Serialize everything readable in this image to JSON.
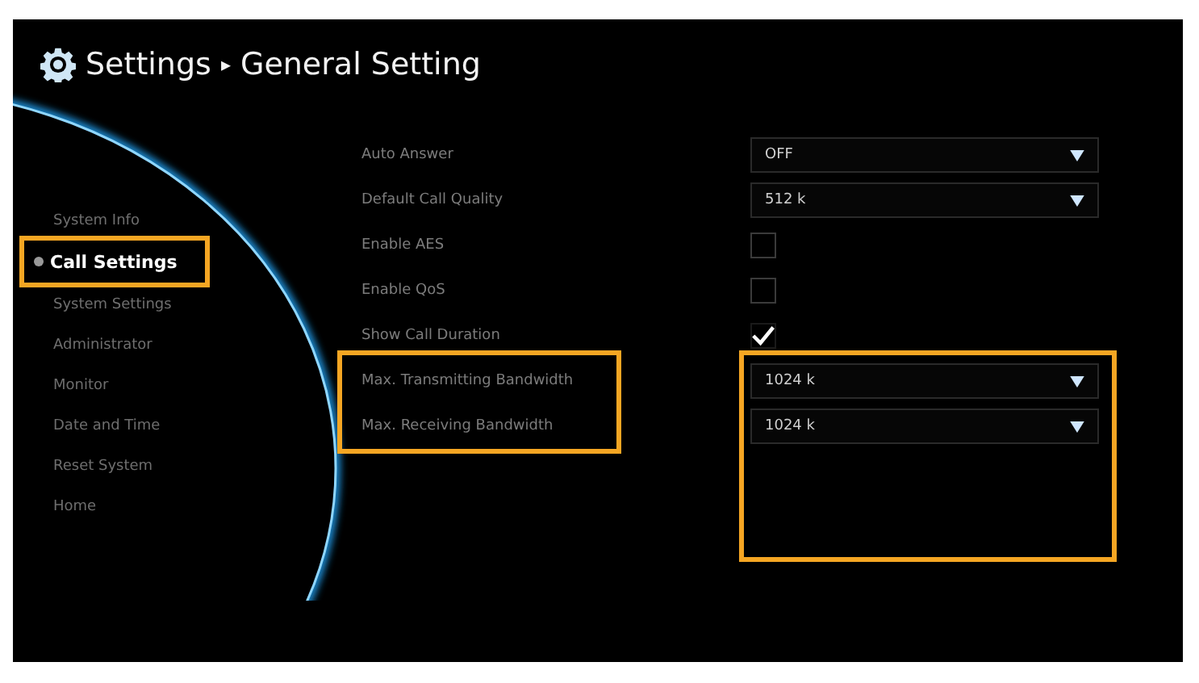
{
  "title": {
    "section": "Settings",
    "separator": "▸",
    "page": "General Setting"
  },
  "sidebar": {
    "items": [
      {
        "label": "System Info",
        "selected": false,
        "highlighted": false
      },
      {
        "label": "Call Settings",
        "selected": true,
        "highlighted": true
      },
      {
        "label": "System Settings",
        "selected": false,
        "highlighted": false
      },
      {
        "label": "Administrator",
        "selected": false,
        "highlighted": false
      },
      {
        "label": "Monitor",
        "selected": false,
        "highlighted": false
      },
      {
        "label": "Date and Time",
        "selected": false,
        "highlighted": false
      },
      {
        "label": "Reset System",
        "selected": false,
        "highlighted": false
      },
      {
        "label": "Home",
        "selected": false,
        "highlighted": false
      }
    ]
  },
  "settings": [
    {
      "kind": "dropdown",
      "label": "Auto Answer",
      "value": "OFF"
    },
    {
      "kind": "dropdown",
      "label": "Default Call Quality",
      "value": "512 k"
    },
    {
      "kind": "checkbox",
      "label": "Enable AES",
      "checked": false
    },
    {
      "kind": "checkbox",
      "label": "Enable QoS",
      "checked": false
    },
    {
      "kind": "checkbox",
      "label": "Show Call Duration",
      "checked": true
    }
  ],
  "bandwidth": {
    "highlighted": true,
    "rows": [
      {
        "kind": "dropdown",
        "label": "Max. Transmitting Bandwidth",
        "value": "1024 k"
      },
      {
        "kind": "dropdown",
        "label": "Max. Receiving Bandwidth",
        "value": "1024 k"
      }
    ]
  }
}
